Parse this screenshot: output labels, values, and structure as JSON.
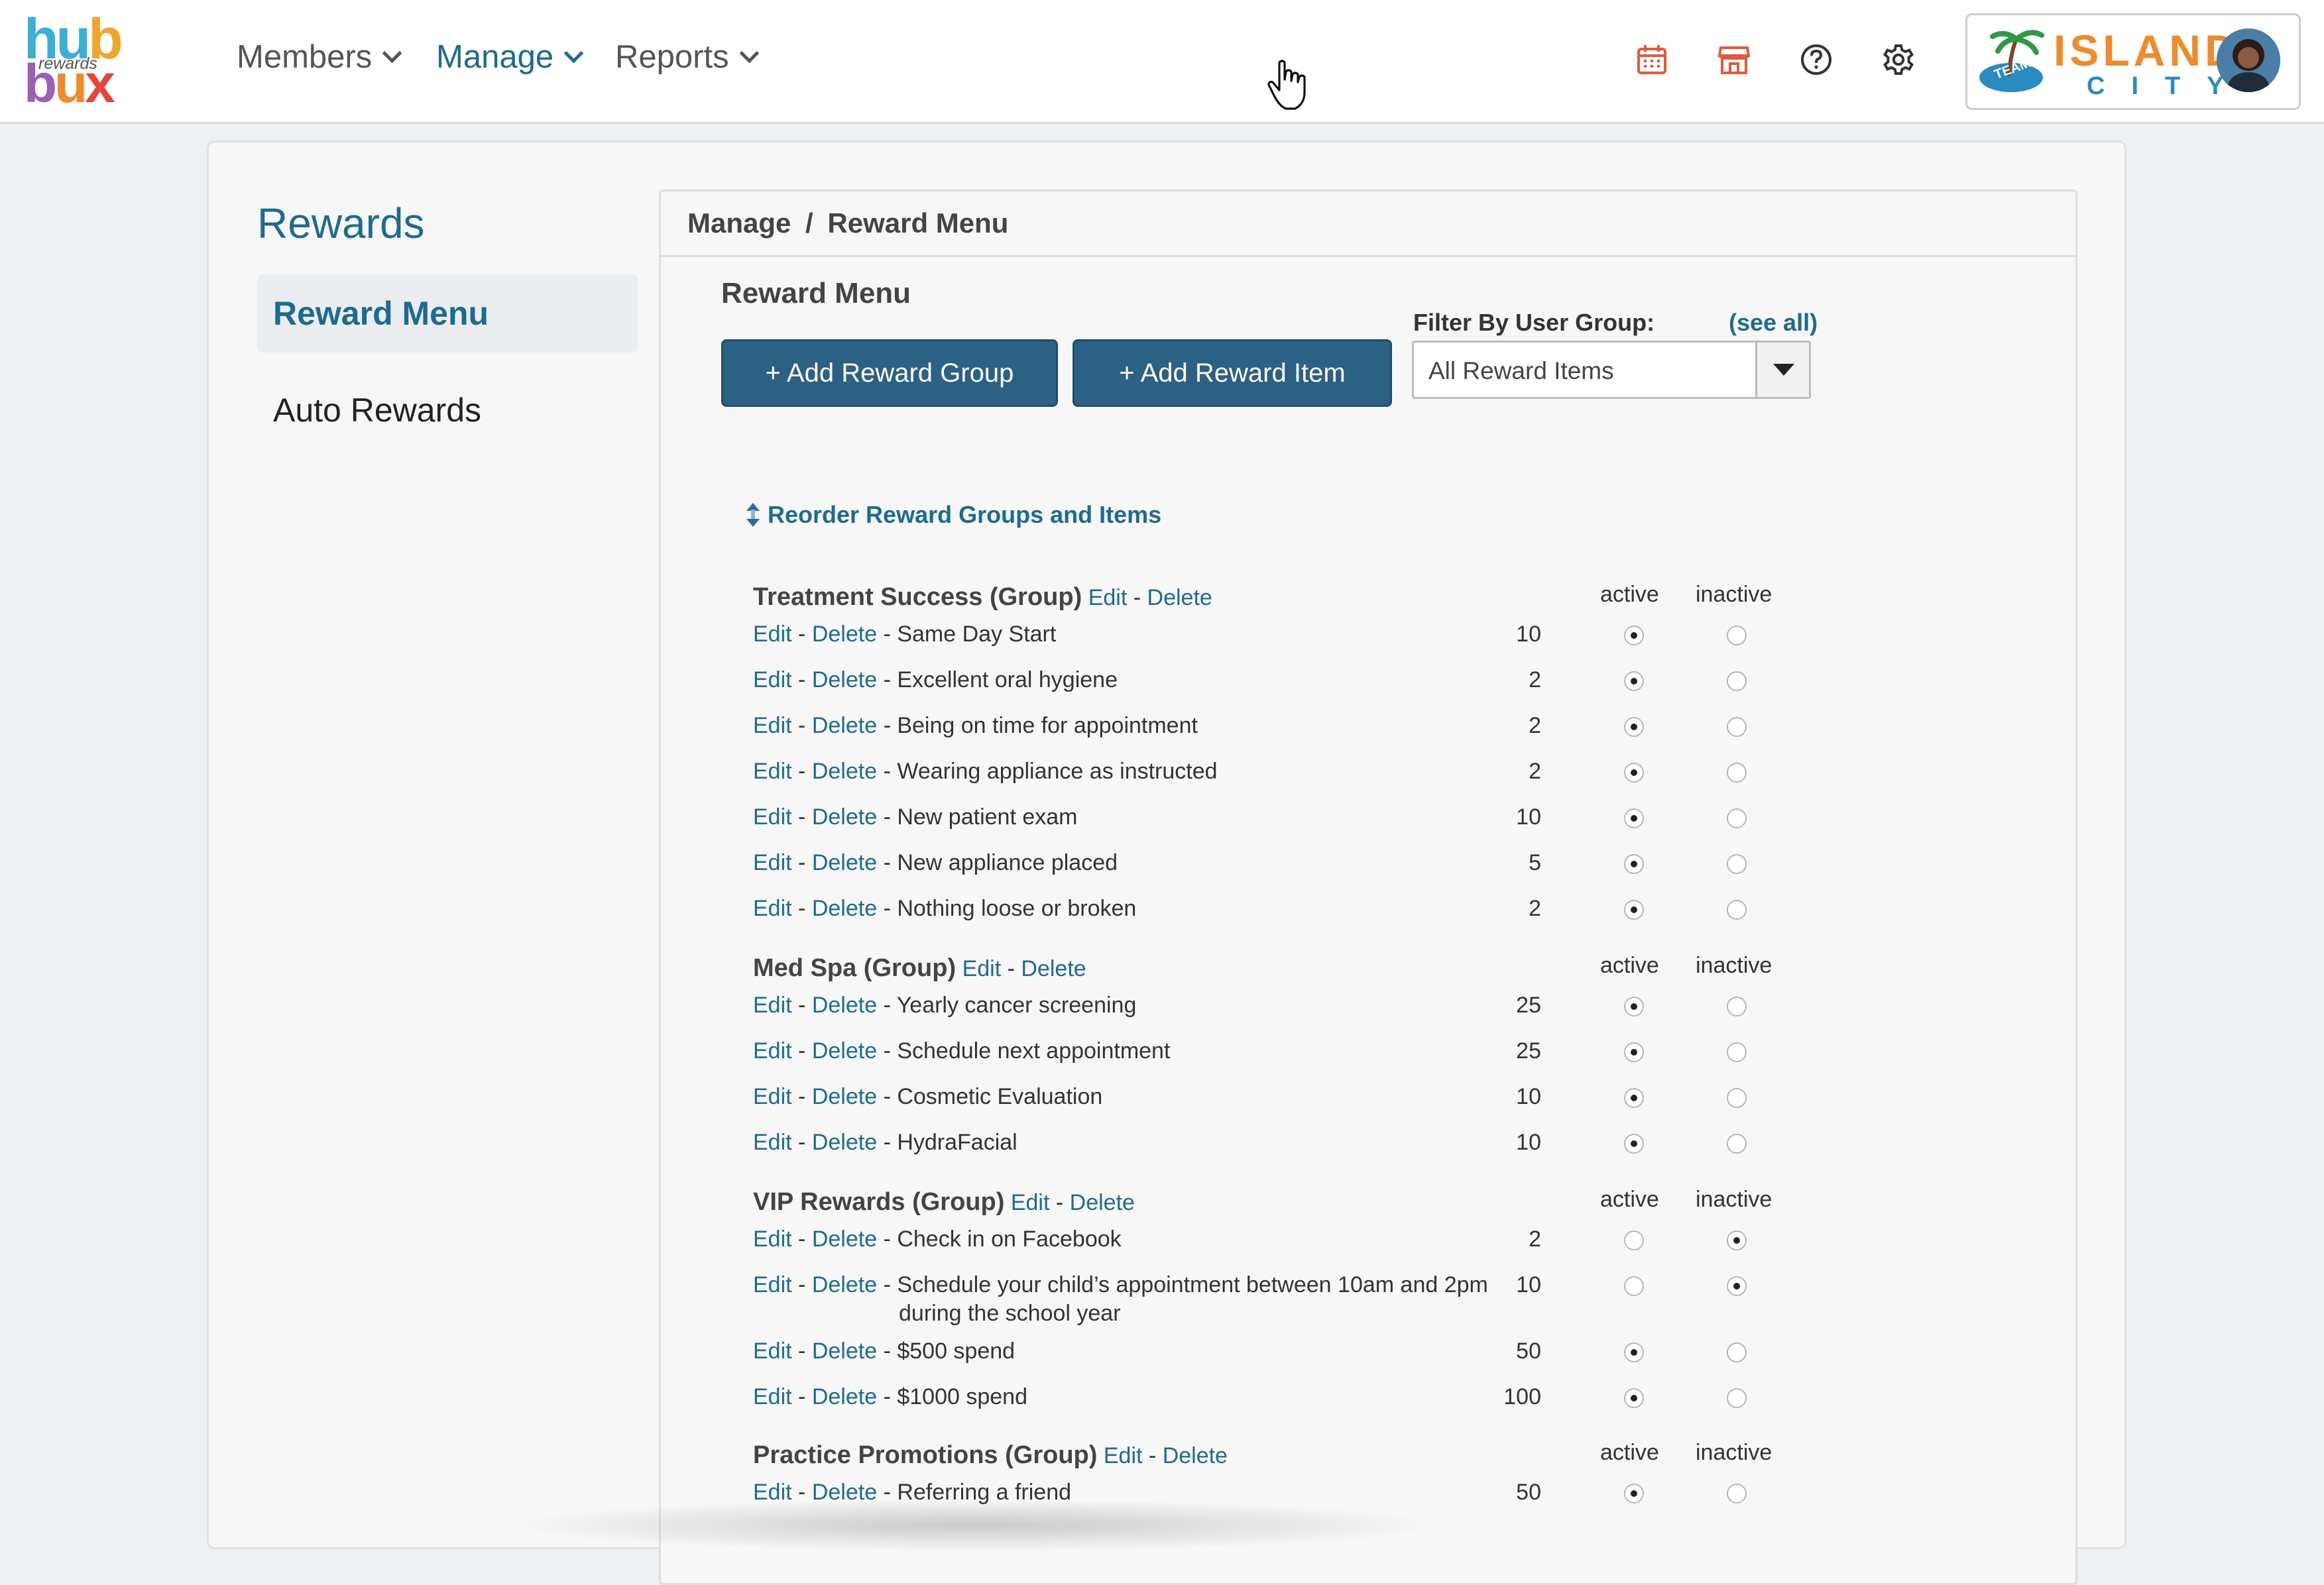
{
  "brand": {
    "hub": "hub",
    "rewards": "rewards",
    "bux": "bux"
  },
  "nav": {
    "members": "Members",
    "manage": "Manage",
    "reports": "Reports"
  },
  "header_icons": [
    "calendar-icon",
    "store-icon",
    "help-icon",
    "gear-icon"
  ],
  "practice_logo": {
    "line1": "ISLAND",
    "line2": "CITY",
    "badge": "TEAM"
  },
  "sidebar": {
    "title": "Rewards",
    "items": [
      {
        "label": "Reward Menu",
        "selected": true
      },
      {
        "label": "Auto Rewards",
        "selected": false
      }
    ]
  },
  "breadcrumb": {
    "root": "Manage",
    "sep": "/",
    "current": "Reward Menu"
  },
  "main": {
    "title": "Reward Menu",
    "add_group": "+ Add Reward Group",
    "add_item": "+ Add Reward Item",
    "filter_label": "Filter By User Group:",
    "see_all": "(see all)",
    "filter_value": "All Reward Items",
    "reorder": "Reorder Reward Groups and Items"
  },
  "labels": {
    "edit": "Edit",
    "delete": "Delete",
    "dash": "-",
    "active": "active",
    "inactive": "inactive"
  },
  "groups": [
    {
      "name": "Treatment Success (Group)",
      "items": [
        {
          "name": "Same Day Start",
          "points": "10",
          "active": true
        },
        {
          "name": "Excellent oral hygiene",
          "points": "2",
          "active": true
        },
        {
          "name": "Being on time for appointment",
          "points": "2",
          "active": true
        },
        {
          "name": "Wearing appliance as instructed",
          "points": "2",
          "active": true
        },
        {
          "name": "New patient exam",
          "points": "10",
          "active": true
        },
        {
          "name": "New appliance placed",
          "points": "5",
          "active": true
        },
        {
          "name": "Nothing loose or broken",
          "points": "2",
          "active": true
        }
      ]
    },
    {
      "name": "Med Spa (Group)",
      "items": [
        {
          "name": "Yearly cancer screening",
          "points": "25",
          "active": true
        },
        {
          "name": "Schedule next appointment",
          "points": "25",
          "active": true
        },
        {
          "name": "Cosmetic Evaluation",
          "points": "10",
          "active": true
        },
        {
          "name": "HydraFacial",
          "points": "10",
          "active": true
        }
      ]
    },
    {
      "name": "VIP Rewards (Group)",
      "items": [
        {
          "name": "Check in on Facebook",
          "points": "2",
          "active": false
        },
        {
          "name": "Schedule your child’s appointment between 10am and 2pm",
          "name_line2": "during the school year",
          "points": "10",
          "active": false
        },
        {
          "name": "$500 spend",
          "points": "50",
          "active": true
        },
        {
          "name": "$1000 spend",
          "points": "100",
          "active": true
        }
      ]
    },
    {
      "name": "Practice Promotions (Group)",
      "items": [
        {
          "name": "Referring a friend",
          "points": "50",
          "active": true
        }
      ]
    }
  ]
}
